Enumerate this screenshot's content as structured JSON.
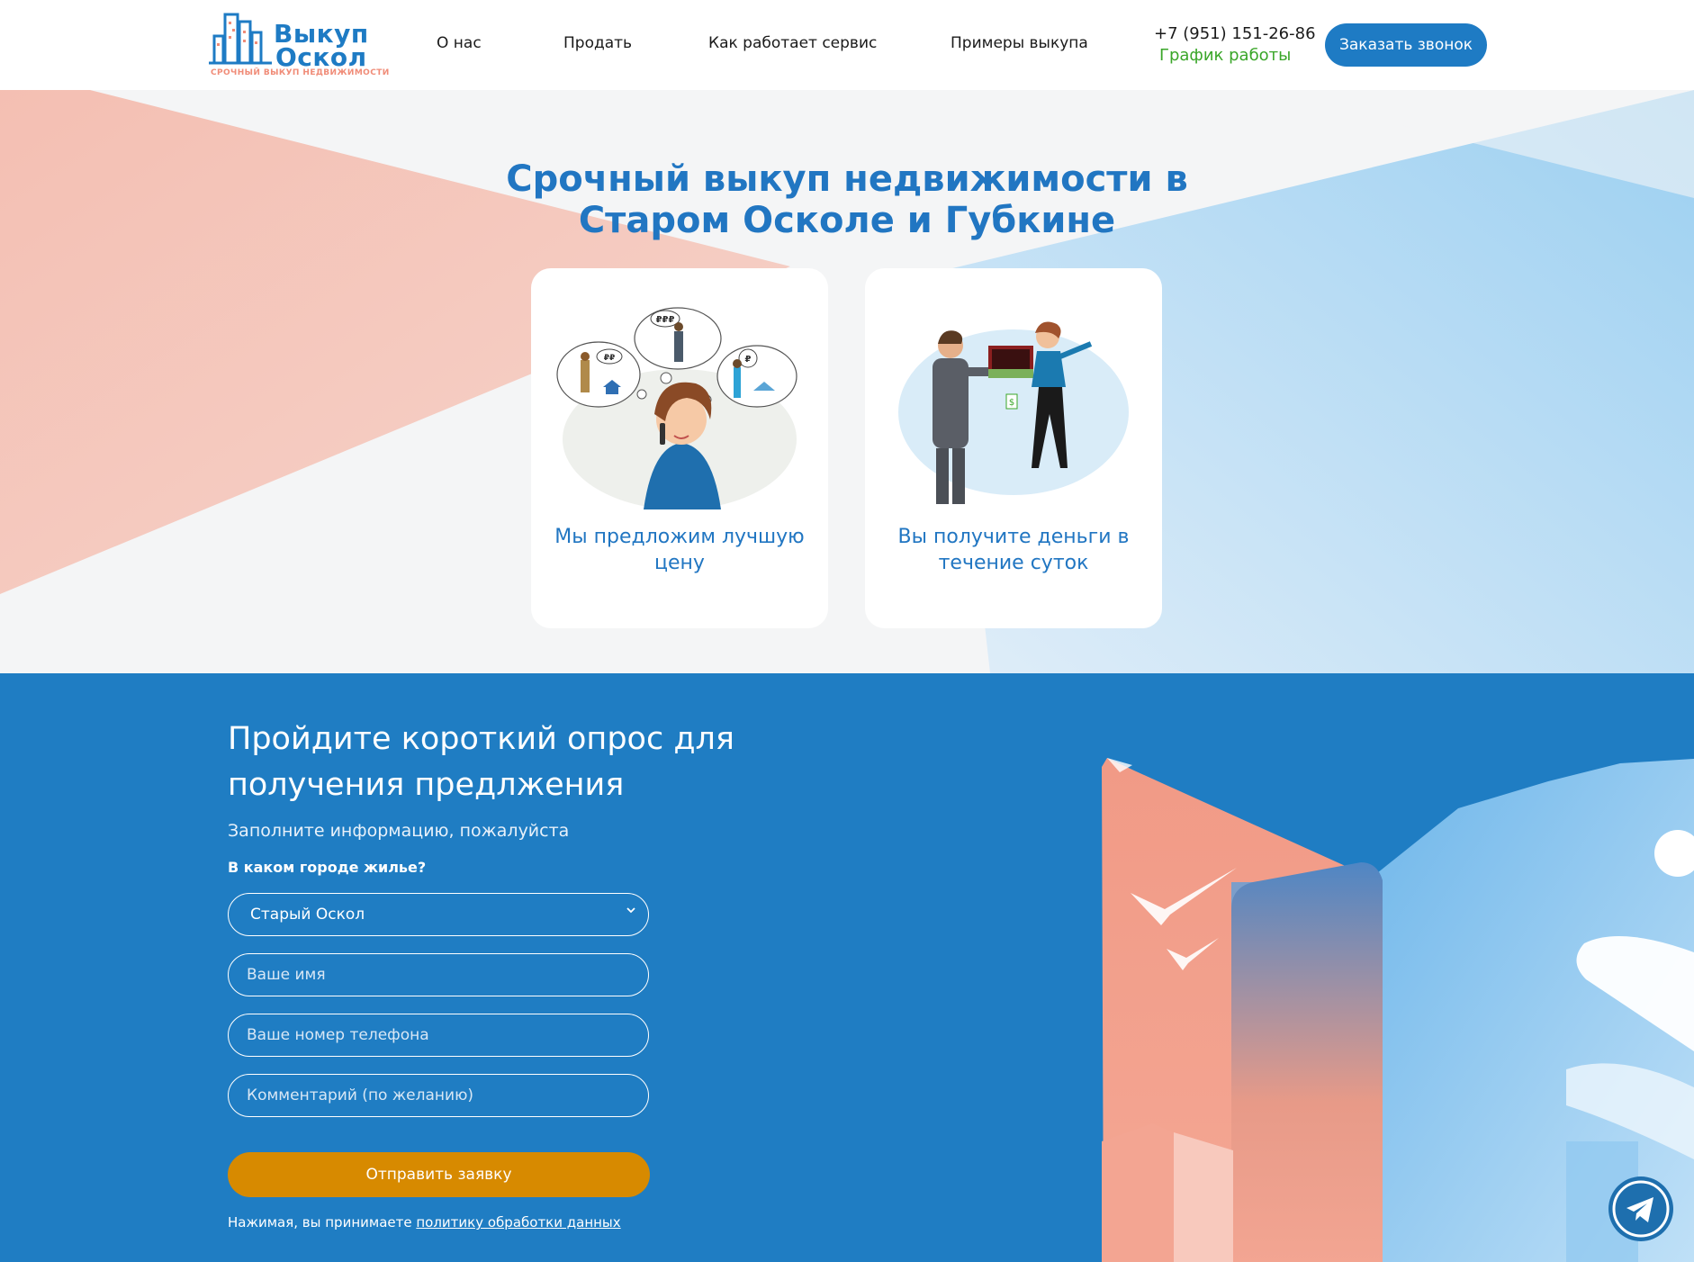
{
  "header": {
    "logo": {
      "word1": "Выкуп",
      "word2": "Оскол",
      "tagline": "СРОЧНЫЙ ВЫКУП НЕДВИЖИМОСТИ"
    },
    "nav": [
      {
        "label": "О нас"
      },
      {
        "label": "Продать"
      },
      {
        "label": "Как работает сервис"
      },
      {
        "label": "Примеры выкупа"
      }
    ],
    "phone": "+7 (951) 151-26-86",
    "schedule_link": "График работы",
    "call_button": "Заказать звонок"
  },
  "hero": {
    "title_line1": "Срочный выкуп недвижимости в",
    "title_line2": "Старом Осколе и Губкине",
    "cards": [
      {
        "text": "Мы предложим лучшую цену",
        "bubble_labels": [
          "₽₽₽",
          "₽₽",
          "₽"
        ]
      },
      {
        "text": "Вы получите деньги в течение суток",
        "tag_label": "$"
      }
    ]
  },
  "form": {
    "title": "Пройдите короткий опрос для получения предлжения",
    "subtitle": "Заполните информацию, пожалуйста",
    "city_question": "В каком городе жилье?",
    "city_selected": "Старый Оскол",
    "name_placeholder": "Ваше имя",
    "phone_placeholder": "Ваше номер телефона",
    "comment_placeholder": "Комментарий (по желанию)",
    "submit_label": "Отправить заявку",
    "consent_text": "Нажимая, вы принимаете ",
    "consent_link": "политику обработки данных"
  },
  "colors": {
    "brand_blue": "#1e7bc4",
    "section_blue": "#1f7dc3",
    "accent_orange": "#d78a00",
    "schedule_green": "#3aa629",
    "salmon": "#f08c78"
  },
  "icons": {
    "floating_button": "telegram-icon",
    "select_arrow": "chevron-down-icon",
    "logo_mark": "buildings-icon"
  }
}
